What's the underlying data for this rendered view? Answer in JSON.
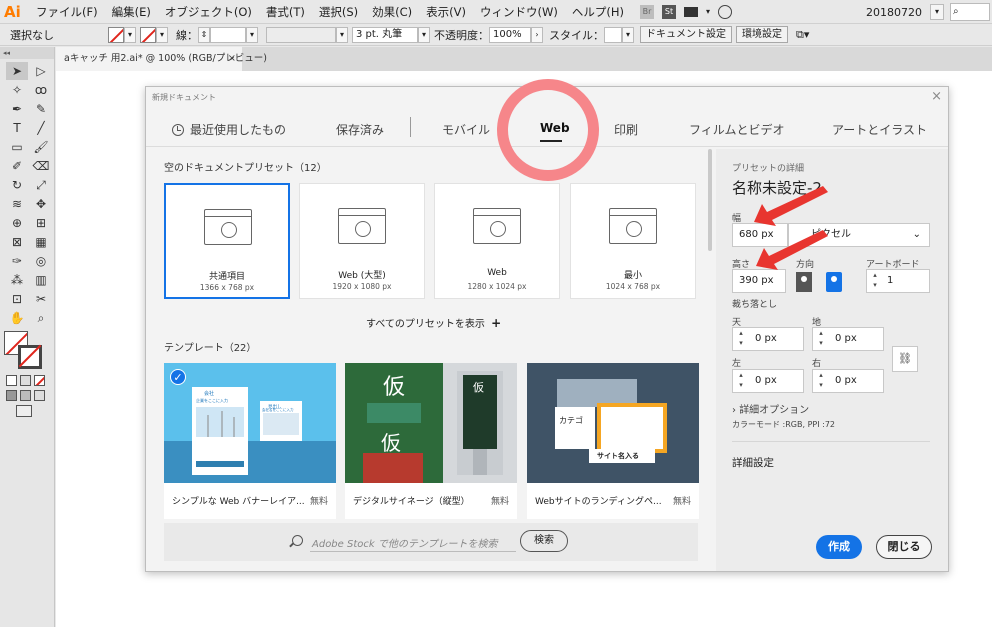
{
  "menubar": {
    "app_logo": "Ai",
    "items": [
      "ファイル(F)",
      "編集(E)",
      "オブジェクト(O)",
      "書式(T)",
      "選択(S)",
      "効果(C)",
      "表示(V)",
      "ウィンドウ(W)",
      "ヘルプ(H)"
    ],
    "badge_br": "Br",
    "badge_st": "St",
    "date": "20180720"
  },
  "controlbar": {
    "selection": "選択なし",
    "stroke_label": "線：",
    "brush": "3 pt. 丸筆",
    "opacity_label": "不透明度：",
    "opacity_value": "100%",
    "style_label": "スタイル：",
    "doc_setup": "ドキュメント設定",
    "prefs": "環境設定"
  },
  "doc_tab": {
    "title": "aキャッチ 用2.ai* @ 100% (RGB/プレビュー)",
    "close": "×"
  },
  "dialog": {
    "title": "新規ドキュメント",
    "close": "×",
    "tabs": [
      "最近使用したもの",
      "保存済み",
      "モバイル",
      "Web",
      "印刷",
      "フィルムとビデオ",
      "アートとイラスト"
    ],
    "active_tab": "Web",
    "presets_label": "空のドキュメントプリセット（12）",
    "presets": [
      {
        "name": "共通項目",
        "size": "1366 x 768 px"
      },
      {
        "name": "Web (大型)",
        "size": "1920 x 1080 px"
      },
      {
        "name": "Web",
        "size": "1280 x 1024 px"
      },
      {
        "name": "最小",
        "size": "1024 x 768 px"
      }
    ],
    "show_all": "すべてのプリセットを表示",
    "plus": "+",
    "templates_label": "テンプレート（22）",
    "templates": [
      {
        "name": "シンプルな Web バナーレイア...",
        "badge": "無料"
      },
      {
        "name": "デジタルサイネージ（縦型）",
        "badge": "無料"
      },
      {
        "name": "Webサイトのランディングペ...",
        "badge": "無料"
      }
    ],
    "tpl1_text": {
      "line1": "会社",
      "line2": "企業をここに入力",
      "card": "見出し",
      "card_sub": "会社名をここに入力"
    },
    "tpl2_text": {
      "k1": "仮",
      "k2": "仮",
      "k3": "仮"
    },
    "tpl3_text": {
      "head": "カテゴ",
      "bottom": "サイト名入る"
    },
    "stock_placeholder": "Adobe Stock で他のテンプレートを検索",
    "search_button": "検索",
    "details": {
      "header": "プリセットの詳細",
      "name": "名称未設定-2",
      "width_label": "幅",
      "width_value": "680 px",
      "unit": "ピクセル",
      "height_label": "高さ",
      "height_value": "390 px",
      "orientation_label": "方向",
      "artboard_label": "アートボード",
      "artboard_value": "1",
      "bleed_label": "裁ち落とし",
      "top_label": "天",
      "bottom_label": "地",
      "left_label": "左",
      "right_label": "右",
      "top_value": "0 px",
      "bottom_value": "0 px",
      "left_value": "0 px",
      "right_value": "0 px",
      "advanced_options": "詳細オプション",
      "color_mode": "カラーモード :RGB, PPI :72",
      "more_settings": "詳細設定",
      "create": "作成",
      "close": "閉じる"
    }
  },
  "colors": {
    "accent": "#1473e6",
    "annotation": "#f6868a",
    "arrow": "#e8352f"
  }
}
